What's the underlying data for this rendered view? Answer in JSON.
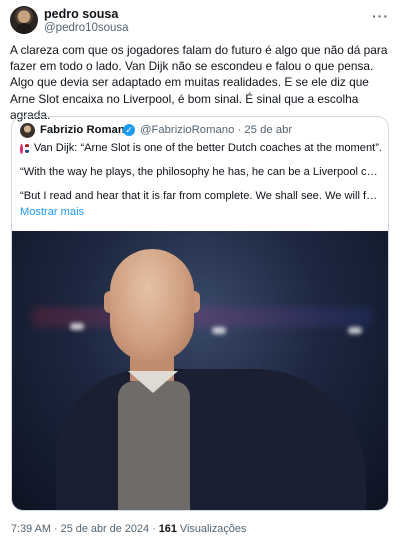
{
  "author": {
    "name": "pedro sousa",
    "handle": "@pedro10sousa",
    "more_icon": "more-horizontal-icon"
  },
  "tweet": {
    "text": "A clareza com que os jogadores falam do futuro é algo que não dá para fazer em todo o lado. Van Dijk não se escondeu e falou o que pensa. Algo que devia ser adaptado em muitas realidades. E se ele diz que Arne Slot encaixa no Liverpool, é bom sinal. É sinal que a escolha agrada."
  },
  "quote": {
    "name": "Fabrizio Romano",
    "verified_icon": "verified-badge-icon",
    "verified_glyph": "✓",
    "handle_date": "@FabrizioRomano · 25 de abr",
    "line1": "Van Dijk: “Arne Slot is one of the better Dutch coaches at the moment”.",
    "line2": "“With the way he plays, the philosophy he has, he can be a Liverpool coach”.",
    "line3": "“But I read and hear that it is far from complete. We shall see. We will focus o...",
    "show_more": "Mostrar mais"
  },
  "meta": {
    "time_date": "7:39 AM · 25 de abr de 2024 · ",
    "views_count": "161",
    "views_label": " Visualizações"
  },
  "colors": {
    "text": "#0f1419",
    "secondary": "#536471",
    "link": "#1d9bf0",
    "border": "#cfd9de"
  }
}
